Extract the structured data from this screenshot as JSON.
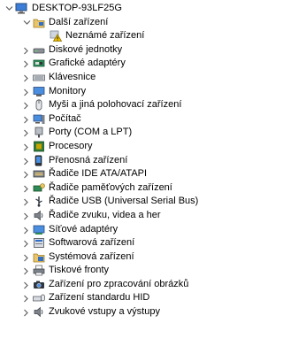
{
  "root": {
    "label": "DESKTOP-93LF25G",
    "icon": "computer-icon",
    "expanded": true
  },
  "other_devices": {
    "label": "Další zařízení",
    "icon": "other-devices-icon",
    "expanded": true,
    "child": {
      "label": "Neznámé zařízení",
      "icon": "unknown-device-warning-icon"
    }
  },
  "categories": [
    {
      "label": "Diskové jednotky",
      "icon": "disk-drive-icon"
    },
    {
      "label": "Grafické adaptéry",
      "icon": "display-adapter-icon"
    },
    {
      "label": "Klávesnice",
      "icon": "keyboard-icon"
    },
    {
      "label": "Monitory",
      "icon": "monitor-icon"
    },
    {
      "label": "Myši a jiná polohovací zařízení",
      "icon": "mouse-icon"
    },
    {
      "label": "Počítač",
      "icon": "computer-icon"
    },
    {
      "label": "Porty (COM a LPT)",
      "icon": "port-icon"
    },
    {
      "label": "Procesory",
      "icon": "processor-icon"
    },
    {
      "label": "Přenosná zařízení",
      "icon": "portable-device-icon"
    },
    {
      "label": "Řadiče IDE ATA/ATAPI",
      "icon": "ide-controller-icon"
    },
    {
      "label": "Řadiče paměťových zařízení",
      "icon": "storage-controller-icon"
    },
    {
      "label": "Řadiče USB (Universal Serial Bus)",
      "icon": "usb-icon"
    },
    {
      "label": "Řadiče zvuku, videa a her",
      "icon": "speaker-icon"
    },
    {
      "label": "Síťové adaptéry",
      "icon": "network-adapter-icon"
    },
    {
      "label": "Softwarová zařízení",
      "icon": "software-device-icon"
    },
    {
      "label": "Systémová zařízení",
      "icon": "system-device-icon"
    },
    {
      "label": "Tiskové fronty",
      "icon": "printer-icon"
    },
    {
      "label": "Zařízení pro zpracování obrázků",
      "icon": "camera-icon"
    },
    {
      "label": "Zařízení standardu HID",
      "icon": "hid-icon"
    },
    {
      "label": "Zvukové vstupy a výstupy",
      "icon": "audio-io-icon"
    }
  ],
  "colors": {
    "chevron": "#606060",
    "warning": "#f2c200",
    "folder_blue": "#2f6fc6"
  }
}
